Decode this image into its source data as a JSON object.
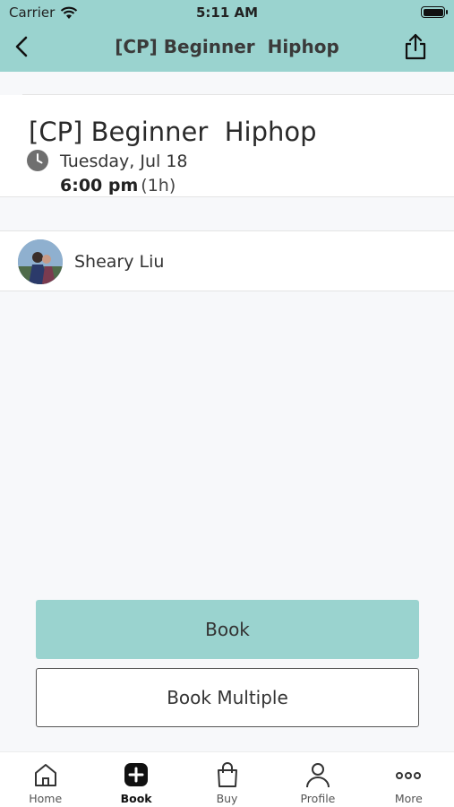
{
  "status_bar": {
    "carrier": "Carrier",
    "time": "5:11 AM"
  },
  "nav": {
    "title": "[CP] Beginner  Hiphop"
  },
  "class": {
    "name": "[CP] Beginner  Hiphop",
    "date": "Tuesday, Jul 18",
    "time": "6:00 pm",
    "duration": "(1h)"
  },
  "instructor": {
    "name": "Sheary Liu"
  },
  "actions": {
    "book_label": "Book",
    "book_multiple_label": "Book Multiple"
  },
  "tabbar": {
    "tabs": [
      {
        "label": "Home",
        "icon": "home-icon"
      },
      {
        "label": "Book",
        "icon": "plus-square-icon",
        "active": true
      },
      {
        "label": "Buy",
        "icon": "shopping-bag-icon"
      },
      {
        "label": "Profile",
        "icon": "person-icon"
      },
      {
        "label": "More",
        "icon": "ellipsis-icon"
      }
    ]
  },
  "colors": {
    "accent": "#9ad3cf",
    "background": "#f7f8fa"
  }
}
